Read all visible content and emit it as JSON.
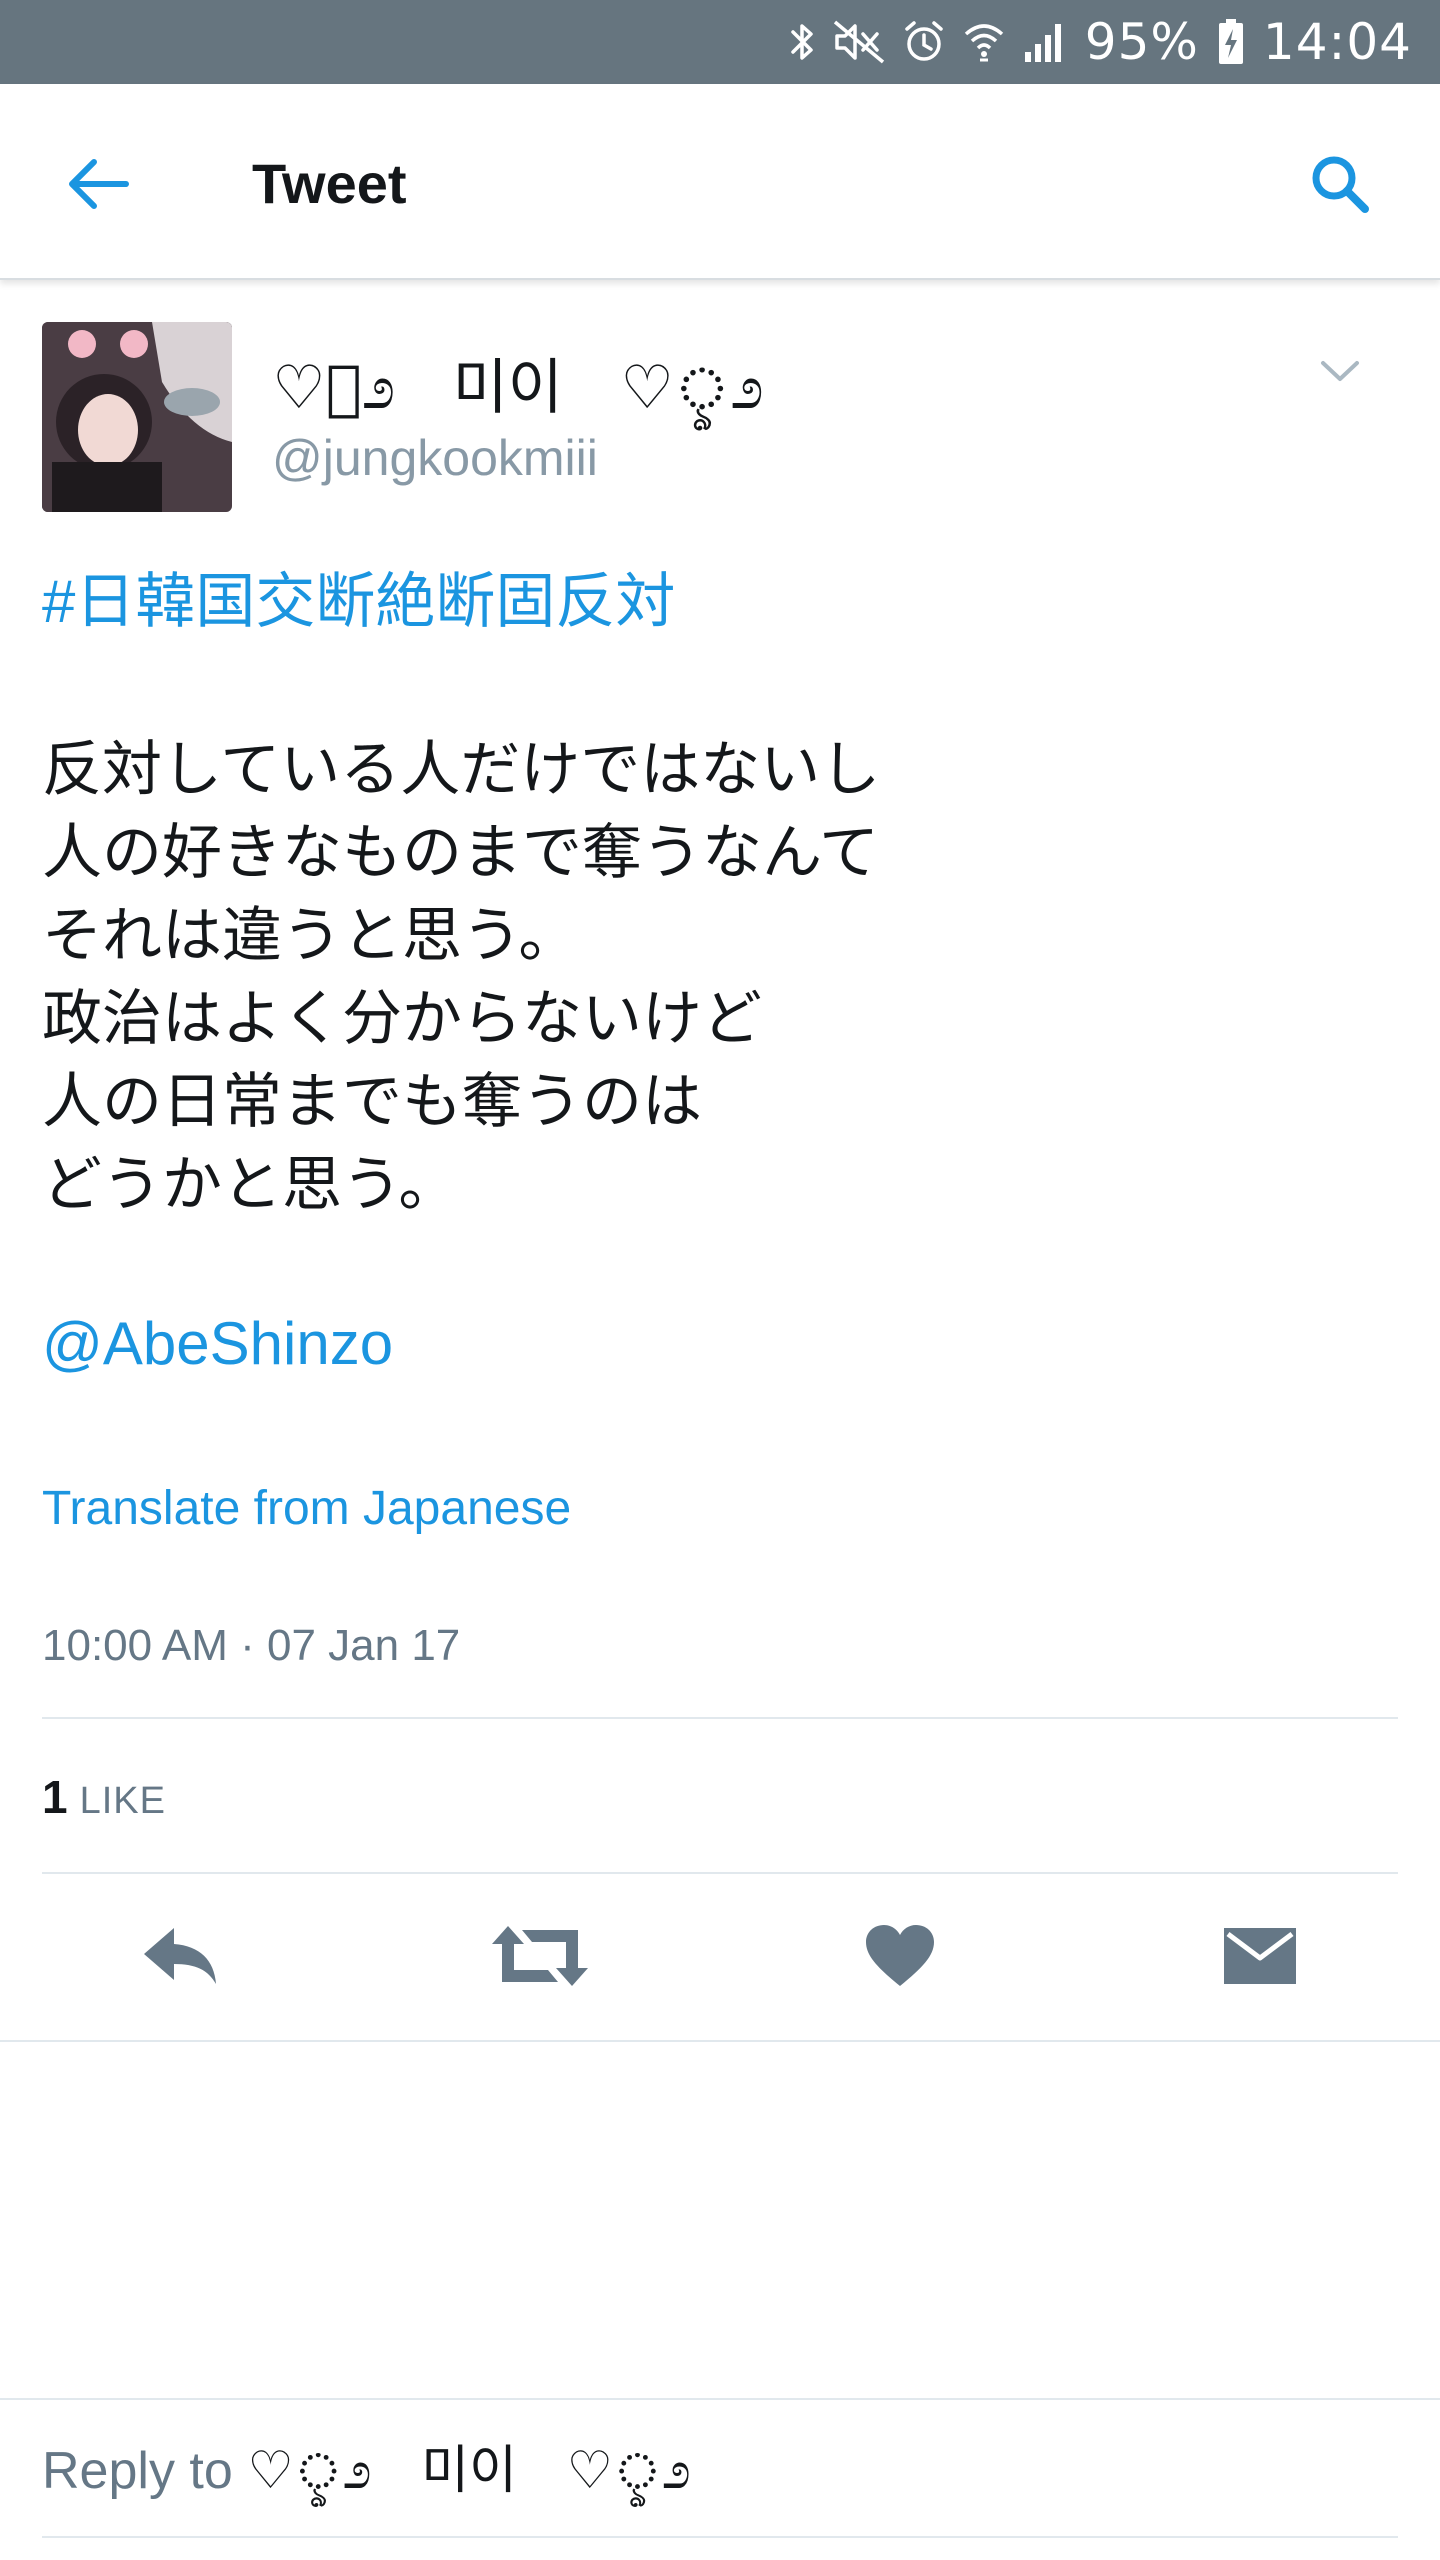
{
  "status_bar": {
    "battery": "95%",
    "time": "14:04",
    "icons": [
      "bluetooth-icon",
      "mute-icon",
      "alarm-icon",
      "wifi-icon",
      "signal-icon",
      "battery-charging-icon"
    ]
  },
  "app_bar": {
    "title": "Tweet",
    "back_icon": "arrow-left-icon",
    "search_icon": "search-icon"
  },
  "tweet": {
    "display_name": "♡ৢ೨   미이   ♡ৢ೨",
    "handle": "@jungkookmiii",
    "hashtag": "#日韓国交断絶断固反対",
    "body_lines": [
      "反対している人だけではないし",
      "人の好きなものまで奪うなんて",
      "それは違うと思う。",
      "政治はよく分からないけど",
      "人の日常までも奪うのは",
      "どうかと思う。"
    ],
    "mention": "@AbeShinzo",
    "translate_label": "Translate from Japanese",
    "timestamp": "10:00 AM · 07 Jan 17",
    "like_count": "1",
    "like_label": "LIKE"
  },
  "actions": [
    {
      "name": "reply-button",
      "icon": "reply-icon"
    },
    {
      "name": "retweet-button",
      "icon": "retweet-icon"
    },
    {
      "name": "like-button",
      "icon": "heart-icon"
    },
    {
      "name": "direct-message-button",
      "icon": "envelope-icon"
    }
  ],
  "reply_bar": {
    "prefix": "Reply to ",
    "name": "♡ৢ೨   미이   ♡ৢ೨"
  },
  "colors": {
    "status_bar_bg": "#66757f",
    "accent_blue": "#1b95e0",
    "action_gray": "#657786",
    "divider": "#e1e8ed"
  }
}
